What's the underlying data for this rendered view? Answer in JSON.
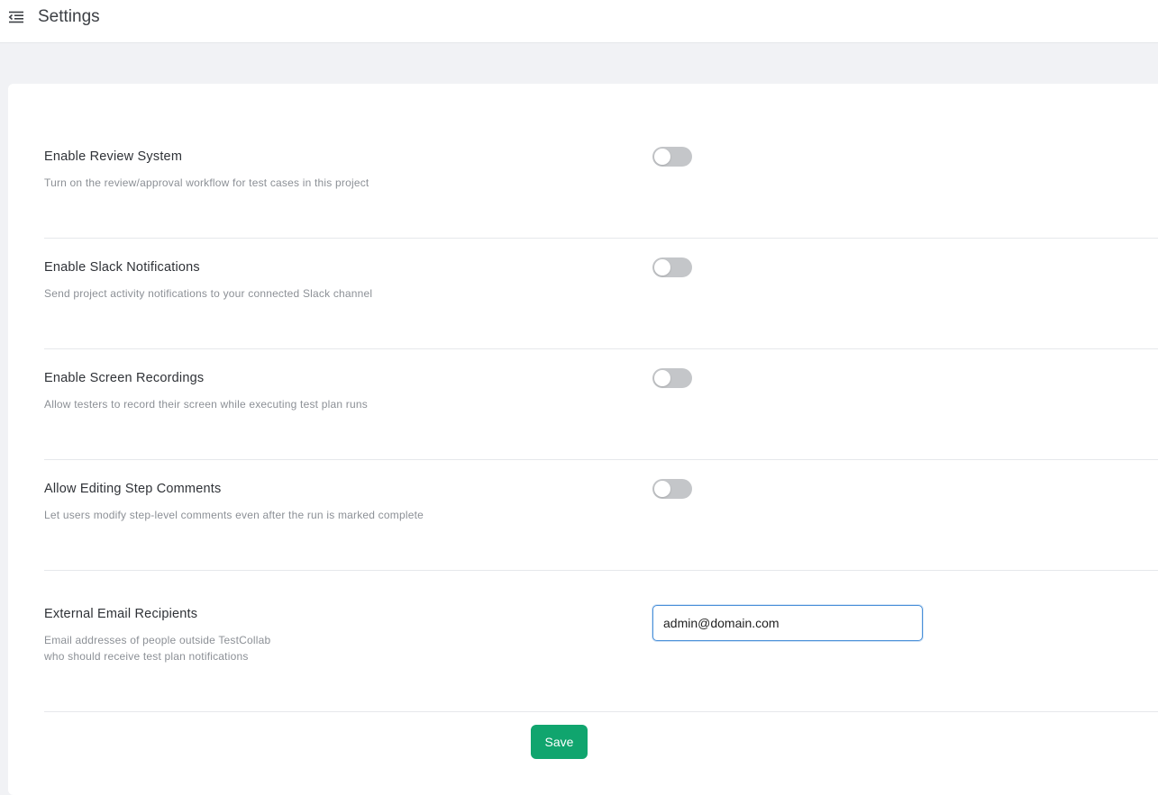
{
  "header": {
    "title": "Settings",
    "menu_icon": "menu-collapse-icon"
  },
  "settings": {
    "review": {
      "label": "Enable Review System",
      "description": "Turn on the review/approval workflow for test cases in this project",
      "enabled": false
    },
    "slack": {
      "label": "Enable Slack Notifications",
      "description": "Send project activity notifications to your connected Slack channel",
      "enabled": false
    },
    "recordings": {
      "label": "Enable Screen Recordings",
      "description": "Allow testers to record their screen while executing test plan runs",
      "enabled": false
    },
    "step_comments": {
      "label": "Allow Editing Step Comments",
      "description": "Let users modify step-level comments even after the run is marked complete",
      "enabled": false
    },
    "external_email": {
      "label": "External Email Recipients",
      "description_line1": "Email addresses of people outside TestCollab",
      "description_line2": "who should receive test plan notifications",
      "value": "admin@domain.com"
    }
  },
  "actions": {
    "save_label": "Save"
  },
  "colors": {
    "accent": "#10a56e",
    "toggle_off": "#c4c6c9",
    "focus_border": "#4a90d9"
  }
}
